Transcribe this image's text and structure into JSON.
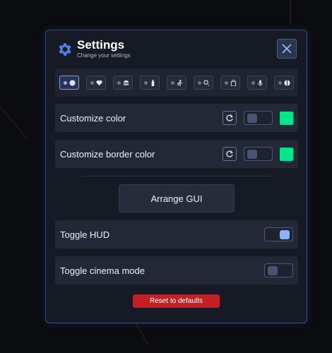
{
  "header": {
    "title": "Settings",
    "subtitle": "Change your settings",
    "icon": "gear-icon",
    "close_icon": "close-icon"
  },
  "tabs": [
    {
      "icon": "toggle-icon",
      "active": true
    },
    {
      "icon": "heart-icon"
    },
    {
      "icon": "burger-icon"
    },
    {
      "icon": "bottle-icon"
    },
    {
      "icon": "running-icon"
    },
    {
      "icon": "oxygen-icon"
    },
    {
      "icon": "backpack-icon"
    },
    {
      "icon": "microphone-icon"
    },
    {
      "icon": "half-circle-icon"
    }
  ],
  "settings": {
    "customize_color": {
      "label": "Customize color",
      "toggle_on": false,
      "color": "#00e68a"
    },
    "customize_border_color": {
      "label": "Customize border color",
      "toggle_on": false,
      "color": "#00e68a"
    },
    "arrange_gui": {
      "label": "Arrange GUI"
    },
    "toggle_hud": {
      "label": "Toggle HUD",
      "toggle_on": true
    },
    "toggle_cinema": {
      "label": "Toggle cinema mode",
      "toggle_on": false
    }
  },
  "footer": {
    "reset_label": "Reset to defaults"
  },
  "colors": {
    "accent": "#8ab4f8",
    "danger": "#c41f24",
    "panel_border": "#3a4a7a"
  }
}
